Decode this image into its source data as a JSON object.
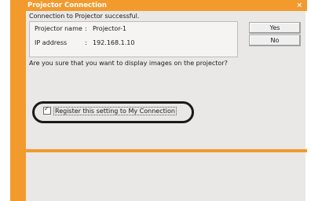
{
  "window": {
    "title": "Projector Connection",
    "close_icon": "close-icon"
  },
  "dialog": {
    "status": "Connection to Projector successful.",
    "projector_name_label": "Projector name",
    "projector_name_value": "Projector-1",
    "ip_address_label": "IP address",
    "ip_address_value": "192.168.1.10",
    "separator": ":",
    "question": "Are you sure that you want to display images on the projector?",
    "checkbox_label": "Register this setting to My Connection",
    "checkbox_checked": true
  },
  "buttons": {
    "yes_label": "Yes",
    "no_label": "No"
  },
  "colors": {
    "accent": "#f29a2e",
    "panel": "#e9e8e6",
    "highlight_ring": "#1a1a1a"
  }
}
